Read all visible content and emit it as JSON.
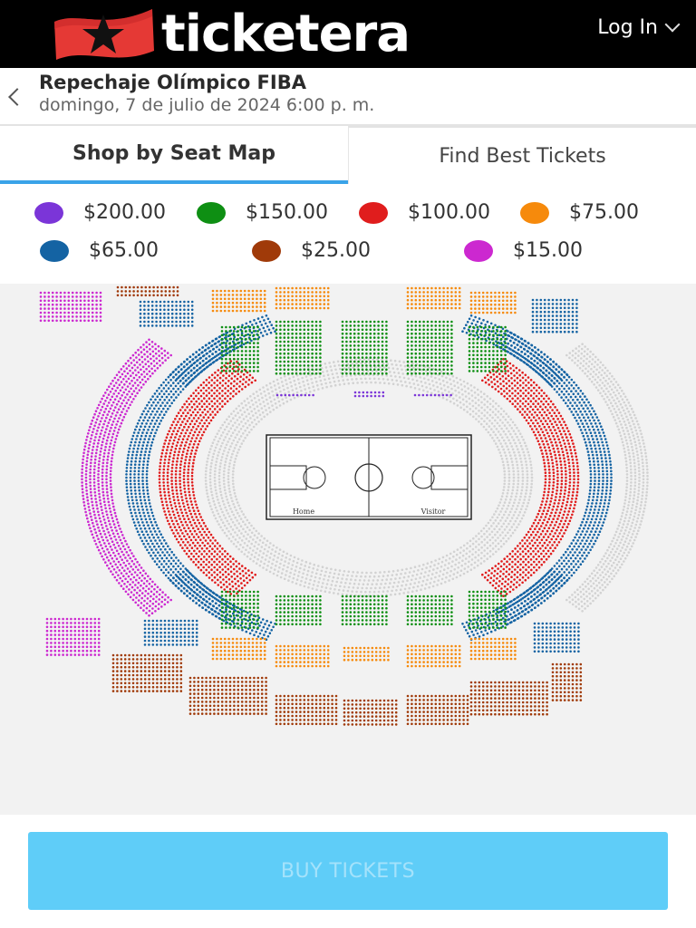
{
  "brand": {
    "name": "ticketera",
    "reg_mark": "®",
    "flag_color": "#e53935"
  },
  "header": {
    "login_label": "Log In"
  },
  "event": {
    "title": "Repechaje Olímpico FIBA",
    "date": "domingo, 7 de julio de 2024 6:00 p. m."
  },
  "tabs": [
    {
      "label": "Shop by Seat Map",
      "active": true
    },
    {
      "label": "Find Best Tickets",
      "active": false
    }
  ],
  "legend": [
    {
      "price": "$200.00",
      "color": "#7b35d8"
    },
    {
      "price": "$150.00",
      "color": "#0e8f13"
    },
    {
      "price": "$100.00",
      "color": "#e01d1d"
    },
    {
      "price": "$75.00",
      "color": "#f68a0c"
    },
    {
      "price": "$65.00",
      "color": "#1463a3"
    },
    {
      "price": "$25.00",
      "color": "#a03a09"
    },
    {
      "price": "$15.00",
      "color": "#cc28d0"
    }
  ],
  "court": {
    "home_label": "Home",
    "visitor_label": "Visitor"
  },
  "buy_button": {
    "label": "BUY TICKETS"
  }
}
